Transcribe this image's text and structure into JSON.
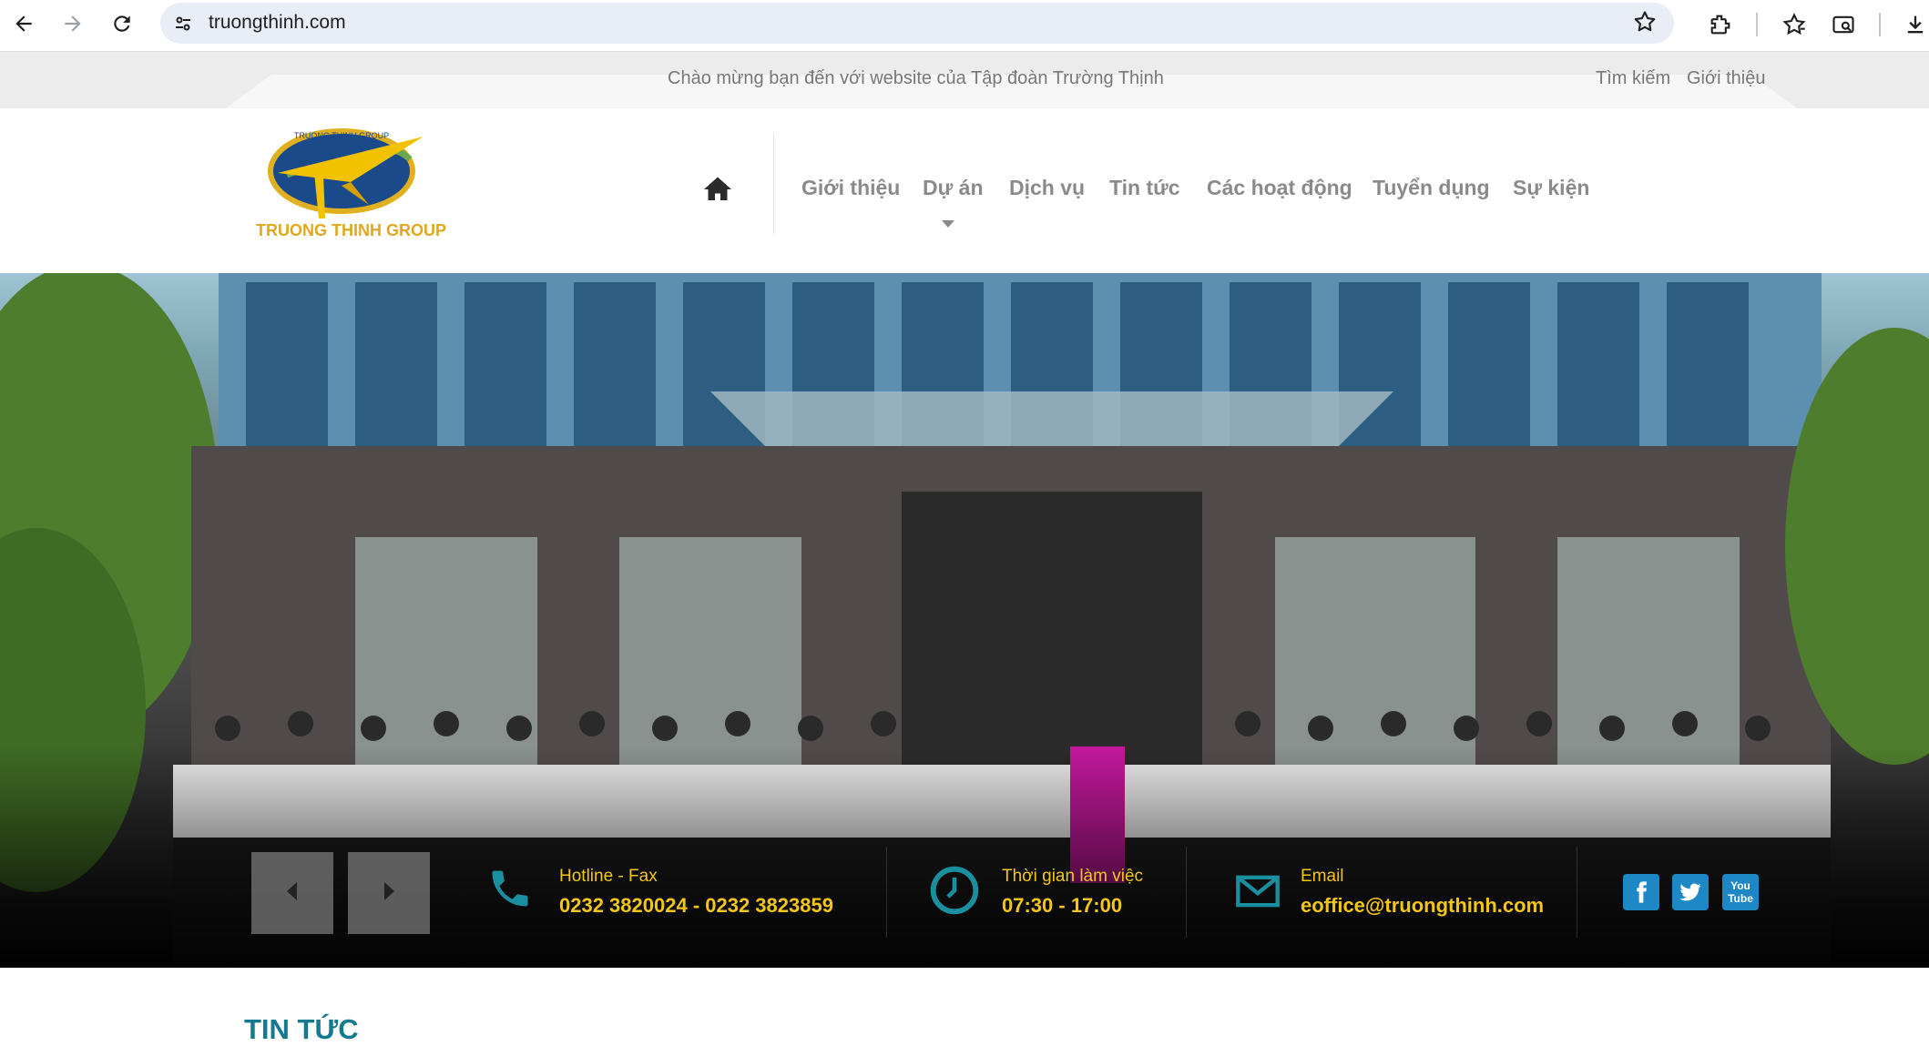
{
  "browser": {
    "url": "truongthinh.com"
  },
  "topbar": {
    "welcome": "Chào mừng bạn đến với website của Tập đoàn Trường Thịnh",
    "search_link": "Tìm kiếm",
    "about_link": "Giới thiệu"
  },
  "logo": {
    "text": "TRUONG THINH GROUP",
    "badge_text": "TRUONG THINH GROUP"
  },
  "menu": {
    "items": [
      "Giới thiệu",
      "Dự án",
      "Dịch vụ",
      "Tin tức",
      "Các hoạt động",
      "Tuyển dụng",
      "Sự kiện"
    ]
  },
  "contact": {
    "hotline_label": "Hotline - Fax",
    "hotline_value": "0232 3820024 - 0232 3823859",
    "hours_label": "Thời gian làm việc",
    "hours_value": "07:30 - 17:00",
    "email_label": "Email",
    "email_value": "eoffice@truongthinh.com"
  },
  "social": {
    "youtube_text": "You Tube"
  },
  "section": {
    "news_title": "TIN TỨC"
  },
  "colors": {
    "accent": "#147a8f",
    "yellow": "#f3c614",
    "menu": "#8a8a8a"
  }
}
